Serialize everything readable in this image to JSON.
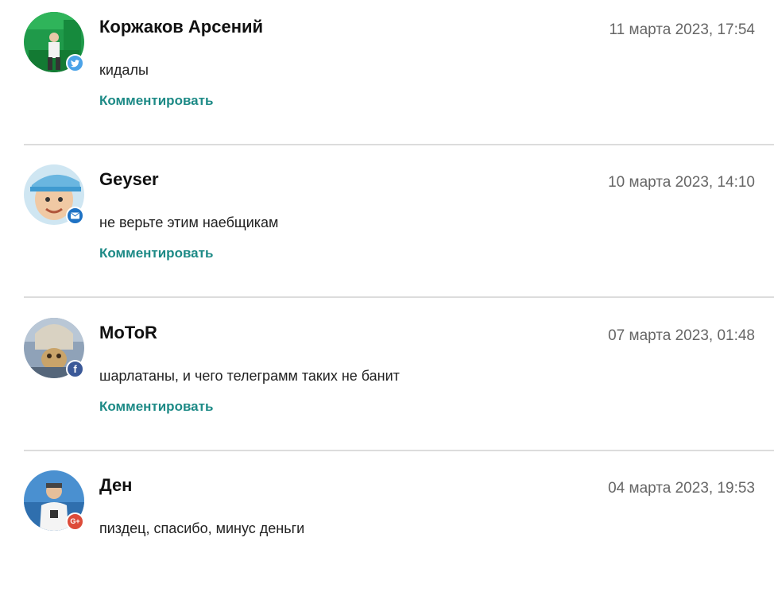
{
  "reply_label": "Комментировать",
  "comments": [
    {
      "author": "Коржаков Арсений",
      "date": "11 марта 2023, 17:54",
      "text": "кидалы",
      "network_icon": "twitter-icon",
      "network_color": "#4ba3e8"
    },
    {
      "author": "Geyser",
      "date": "10 марта 2023, 14:10",
      "text": "не верьте этим наебщикам",
      "network_icon": "mail-icon",
      "network_color": "#1e72c4"
    },
    {
      "author": "MoToR",
      "date": "07 марта 2023, 01:48",
      "text": "шарлатаны, и чего телеграмм таких не банит",
      "network_icon": "facebook-icon",
      "network_color": "#3b5998"
    },
    {
      "author": "Ден",
      "date": "04 марта 2023, 19:53",
      "text": "пиздец, спасибо, минус деньги",
      "network_icon": "google-plus-icon",
      "network_color": "#dd4b39"
    }
  ]
}
